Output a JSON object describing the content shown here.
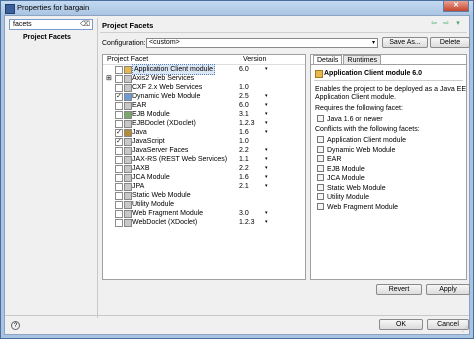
{
  "window": {
    "title": "Properties for bargain",
    "close_label": "✕"
  },
  "left_pane": {
    "filter_value": "facets",
    "nav_items": [
      {
        "label": "Project Facets"
      }
    ]
  },
  "main": {
    "heading": "Project Facets",
    "configuration_label": "Configuration:",
    "configuration_value": "<custom>",
    "save_as_label": "Save As...",
    "delete_label": "Delete",
    "table_headers": {
      "facet": "Project Facet",
      "version": "Version"
    },
    "facets": [
      {
        "name": "Application Client module",
        "version": "6.0",
        "checked": false,
        "dropdown": true,
        "selected": true,
        "icon_color": "#e9b84a"
      },
      {
        "name": "Axis2 Web Services",
        "version": "",
        "checked": false,
        "dropdown": false,
        "expandable": true,
        "icon_color": "#c8c8c8"
      },
      {
        "name": "CXF 2.x Web Services",
        "version": "1.0",
        "checked": false,
        "dropdown": false,
        "icon_color": "#c8c8c8"
      },
      {
        "name": "Dynamic Web Module",
        "version": "2.5",
        "checked": true,
        "dropdown": true,
        "icon_color": "#6a9ed8"
      },
      {
        "name": "EAR",
        "version": "6.0",
        "checked": false,
        "dropdown": true,
        "icon_color": "#c8c8c8"
      },
      {
        "name": "EJB Module",
        "version": "3.1",
        "checked": false,
        "dropdown": true,
        "icon_color": "#7aa86a"
      },
      {
        "name": "EJBDoclet (XDoclet)",
        "version": "1.2.3",
        "checked": false,
        "dropdown": true,
        "icon_color": "#c8c8c8"
      },
      {
        "name": "Java",
        "version": "1.6",
        "checked": true,
        "dropdown": true,
        "icon_color": "#b58a3a"
      },
      {
        "name": "JavaScript",
        "version": "1.0",
        "checked": true,
        "dropdown": false,
        "icon_color": "#c8c8c8"
      },
      {
        "name": "JavaServer Faces",
        "version": "2.2",
        "checked": false,
        "dropdown": true,
        "icon_color": "#c8c8c8"
      },
      {
        "name": "JAX-RS (REST Web Services)",
        "version": "1.1",
        "checked": false,
        "dropdown": true,
        "icon_color": "#c8c8c8"
      },
      {
        "name": "JAXB",
        "version": "2.2",
        "checked": false,
        "dropdown": true,
        "icon_color": "#c8c8c8"
      },
      {
        "name": "JCA Module",
        "version": "1.6",
        "checked": false,
        "dropdown": true,
        "icon_color": "#c8c8c8"
      },
      {
        "name": "JPA",
        "version": "2.1",
        "checked": false,
        "dropdown": true,
        "icon_color": "#c8c8c8"
      },
      {
        "name": "Static Web Module",
        "version": "",
        "checked": false,
        "dropdown": false,
        "icon_color": "#c8c8c8"
      },
      {
        "name": "Utility Module",
        "version": "",
        "checked": false,
        "dropdown": false,
        "icon_color": "#c8c8c8"
      },
      {
        "name": "Web Fragment Module",
        "version": "3.0",
        "checked": false,
        "dropdown": true,
        "icon_color": "#c8c8c8"
      },
      {
        "name": "WebDoclet (XDoclet)",
        "version": "1.2.3",
        "checked": false,
        "dropdown": true,
        "icon_color": "#c8c8c8"
      }
    ]
  },
  "details": {
    "tabs": [
      {
        "label": "Details",
        "active": true
      },
      {
        "label": "Runtimes",
        "active": false
      }
    ],
    "title": "Application Client module 6.0",
    "description_lines": [
      "Enables the project to be deployed as a Java EE",
      "Application Client module."
    ],
    "requires_label": "Requires the following facet:",
    "requires": [
      "Java 1.6 or newer"
    ],
    "conflicts_label": "Conflicts with the following facets:",
    "conflicts": [
      "Application Client module",
      "Dynamic Web Module",
      "EAR",
      "EJB Module",
      "JCA Module",
      "Static Web Module",
      "Utility Module",
      "Web Fragment Module"
    ]
  },
  "buttons": {
    "revert": "Revert",
    "apply": "Apply",
    "ok": "OK",
    "cancel": "Cancel"
  },
  "icons": {
    "help": "?",
    "expand": "⊞",
    "dropdown": "▾"
  }
}
